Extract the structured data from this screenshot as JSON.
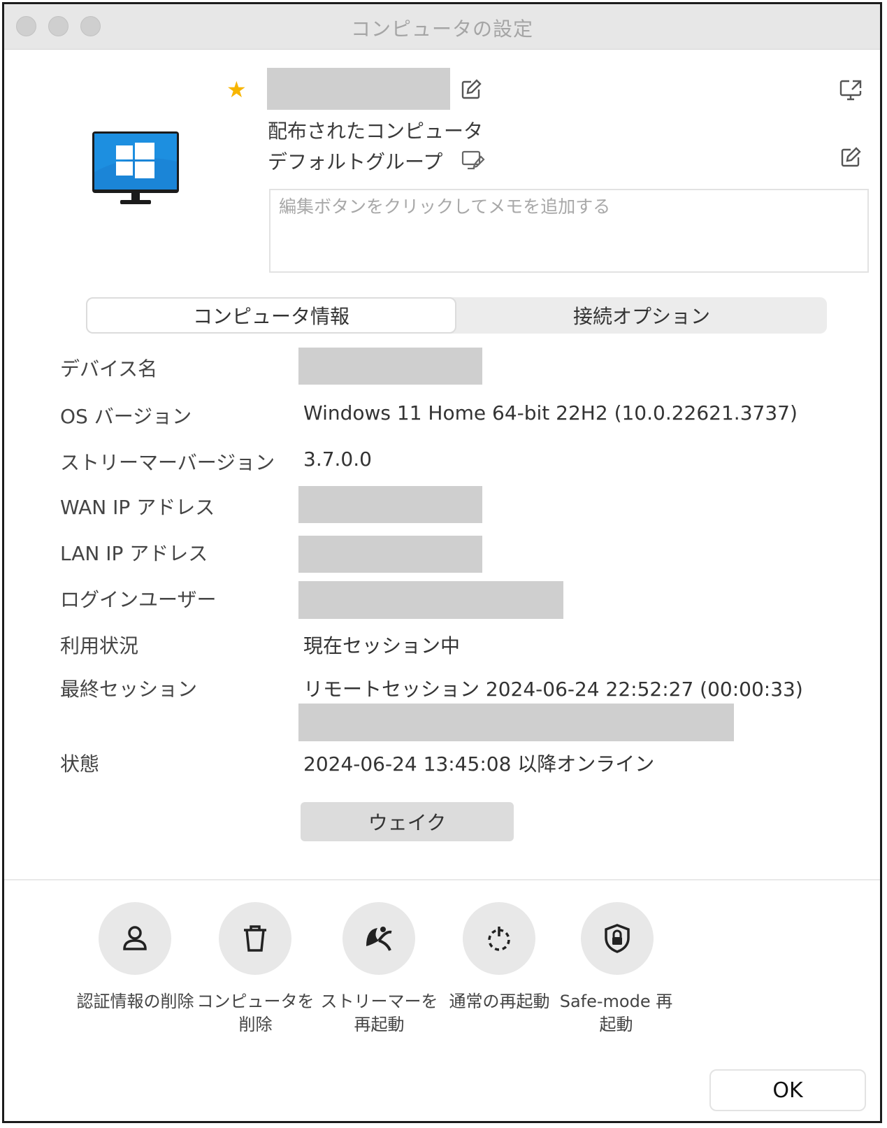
{
  "window": {
    "title": "コンピュータの設定"
  },
  "header": {
    "group_type": "配布されたコンピュータ",
    "group_name": "デフォルトグループ",
    "memo_placeholder": "編集ボタンをクリックしてメモを追加する"
  },
  "tabs": [
    {
      "label": "コンピュータ情報",
      "selected": true
    },
    {
      "label": "接続オプション",
      "selected": false
    }
  ],
  "info": {
    "device_name_label": "デバイス名",
    "os_version_label": "OS バージョン",
    "os_version_value": "Windows 11 Home 64-bit 22H2 (10.0.22621.3737)",
    "streamer_version_label": "ストリーマーバージョン",
    "streamer_version_value": "3.7.0.0",
    "wan_ip_label": "WAN IP アドレス",
    "lan_ip_label": "LAN IP アドレス",
    "login_user_label": "ログインユーザー",
    "usage_label": "利用状況",
    "usage_value": "現在セッション中",
    "last_session_label": "最終セッション",
    "last_session_value": "リモートセッション 2024-06-24 22:52:27 (00:00:33)",
    "status_label": "状態",
    "status_value": "2024-06-24 13:45:08 以降オンライン"
  },
  "wake_button": "ウェイク",
  "actions": [
    {
      "icon": "user-icon",
      "label_line1": "認証情報の削除",
      "label_line2": ""
    },
    {
      "icon": "trash-icon",
      "label_line1": "コンピュータを",
      "label_line2": "削除"
    },
    {
      "icon": "streamer-icon",
      "label_line1": "ストリーマーを",
      "label_line2": "再起動"
    },
    {
      "icon": "restart-icon",
      "label_line1": "通常の再起動",
      "label_line2": ""
    },
    {
      "icon": "shield-lock-icon",
      "label_line1": "Safe-mode 再",
      "label_line2": "起動"
    }
  ],
  "ok_button": "OK",
  "colors": {
    "star": "#f7b500",
    "monitor": "#1d8fe0",
    "redaction": "#cfcfcf"
  }
}
